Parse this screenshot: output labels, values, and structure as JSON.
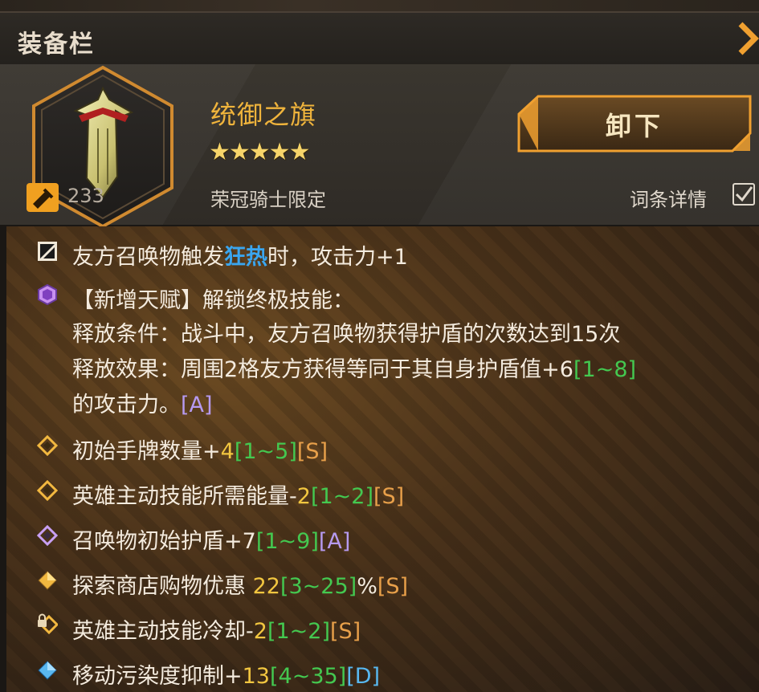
{
  "window": {
    "title": "装备栏"
  },
  "item": {
    "name": "统御之旗",
    "stars": "★★★★★",
    "star_count": 5,
    "source": "荣冠骑士限定",
    "level": "233",
    "icon": "banner-shield-icon"
  },
  "actions": {
    "unequip_label": "卸下",
    "details_label": "词条详情",
    "details_checked": true
  },
  "stats": {
    "row1": {
      "icon": "black-diamond-icon",
      "pre": "友方召唤物触发",
      "hl": "狂热",
      "post": "时，攻击力+1"
    },
    "row2": {
      "icon": "purple-hexagon-icon",
      "line1": "【新增天赋】解锁终极技能：",
      "line2": "释放条件：战斗中，友方召唤物获得护盾的次数达到15次",
      "line3_pre": "释放效果：周围2格友方获得等同于其自身护盾值+6",
      "line3_range": "[1~8]",
      "line4_pre": "的攻击力。",
      "line4_grade": "[A]"
    },
    "row3": {
      "icon": "gold-diamond-icon",
      "label": "初始手牌数量+",
      "value": "4",
      "range": "[1~5]",
      "grade": "[S]"
    },
    "row4": {
      "icon": "gold-diamond-icon",
      "label": "英雄主动技能所需能量-",
      "value": "2",
      "range": "[1~2]",
      "grade": "[S]"
    },
    "row5": {
      "icon": "purple-diamond-icon",
      "label": "召唤物初始护盾+7",
      "range": "[1~9]",
      "grade": "[A]"
    },
    "row6": {
      "icon": "gold-filled-diamond-icon",
      "label": "探索商店购物优惠 ",
      "value": "22",
      "range": "[3~25]",
      "suffix": "%",
      "grade": "[S]"
    },
    "row7": {
      "icon": "lock-diamond-icon",
      "label": "英雄主动技能冷却-",
      "value": "2",
      "range": "[1~2]",
      "grade": "[S]"
    },
    "row8": {
      "icon": "blue-diamond-icon",
      "label": "移动污染度抑制+",
      "value": "13",
      "range": "[4~35]",
      "grade": "[D]"
    }
  },
  "colors": {
    "item_name": "#f0b43c",
    "highlight": "#3aa6f0",
    "range": "#44c850",
    "grade_A": "#b69af0",
    "grade_S": "#e8a04a",
    "grade_D": "#58b8f0"
  }
}
